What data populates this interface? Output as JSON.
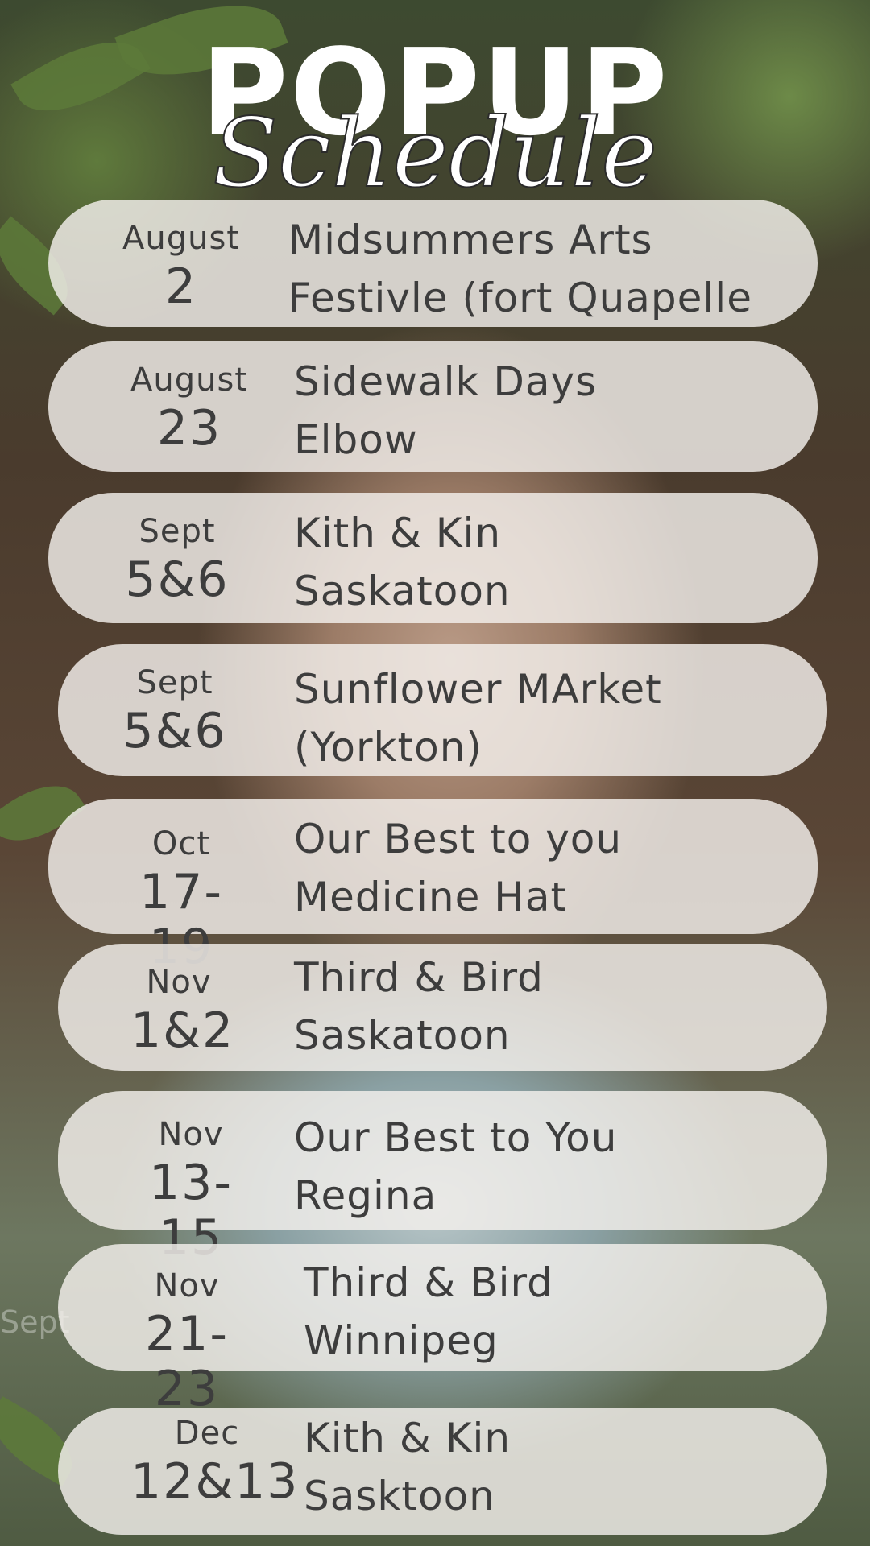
{
  "header": {
    "title": "POPUP",
    "subtitle": "Schedule"
  },
  "events": [
    {
      "month": "August",
      "day": "2",
      "line1": "Midsummers Arts",
      "line2": "Festivle (fort Quapelle"
    },
    {
      "month": "August",
      "day": "23",
      "line1": "Sidewalk Days",
      "line2": "Elbow"
    },
    {
      "month": "Sept",
      "day": "5&6",
      "line1": "Kith & Kin",
      "line2": "Saskatoon"
    },
    {
      "month": "Sept",
      "day": "5&6",
      "line1": "Sunflower MArket",
      "line2": "(Yorkton)"
    },
    {
      "month": "Oct",
      "day": "17-19",
      "line1": "Our Best to you",
      "line2": "Medicine Hat"
    },
    {
      "month": "Nov",
      "day": "1&2",
      "line1": "Third & Bird",
      "line2": "Saskatoon"
    },
    {
      "month": "Nov",
      "day": "13-15",
      "line1": "Our Best to You",
      "line2": "Regina"
    },
    {
      "month": "Nov",
      "day": "21-23",
      "line1": "Third & Bird",
      "line2": "Winnipeg"
    },
    {
      "month": "Dec",
      "day": "12&13",
      "line1": "Kith & Kin",
      "line2": "Sasktoon"
    }
  ],
  "stray_text": "Sept"
}
